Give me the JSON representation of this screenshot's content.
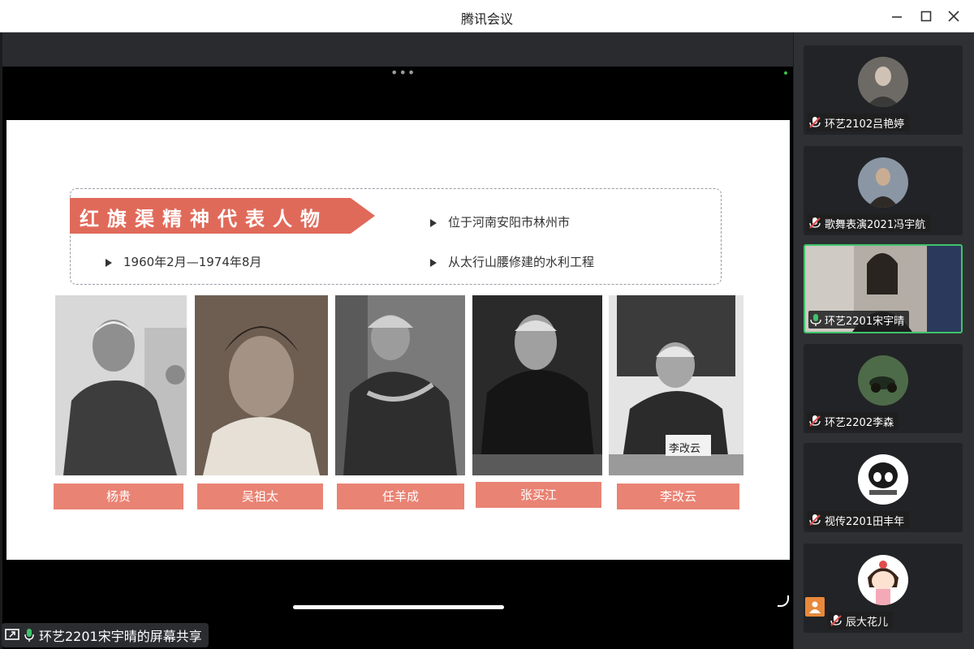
{
  "window": {
    "title": "腾讯会议"
  },
  "share_label": "环艺2201宋宇晴的屏幕共享",
  "slide": {
    "ribbon_title": "红旗渠精神代表人物",
    "bullets": [
      "位于河南安阳市林州市",
      "1960年2月—1974年8月",
      "从太行山腰修建的水利工程"
    ],
    "people": [
      "杨贵",
      "吴祖太",
      "任羊成",
      "张买江",
      "李改云"
    ],
    "photo_caption": "李改云"
  },
  "participants": [
    {
      "name": "环艺2102吕艳婷",
      "muted": true
    },
    {
      "name": "歌舞表演2021冯宇航",
      "muted": true
    },
    {
      "name": "环艺2201宋宇晴",
      "muted": false
    },
    {
      "name": "环艺2202李森",
      "muted": true
    },
    {
      "name": "视传2201田丰年",
      "muted": true
    },
    {
      "name": "辰大花儿",
      "muted": true
    }
  ],
  "colors": {
    "ribbon": "#e06a5a",
    "namebar": "#e98374",
    "active_border": "#3fc46b",
    "mic_active": "#3fc46b",
    "mic_muted": "#e24b4b"
  }
}
